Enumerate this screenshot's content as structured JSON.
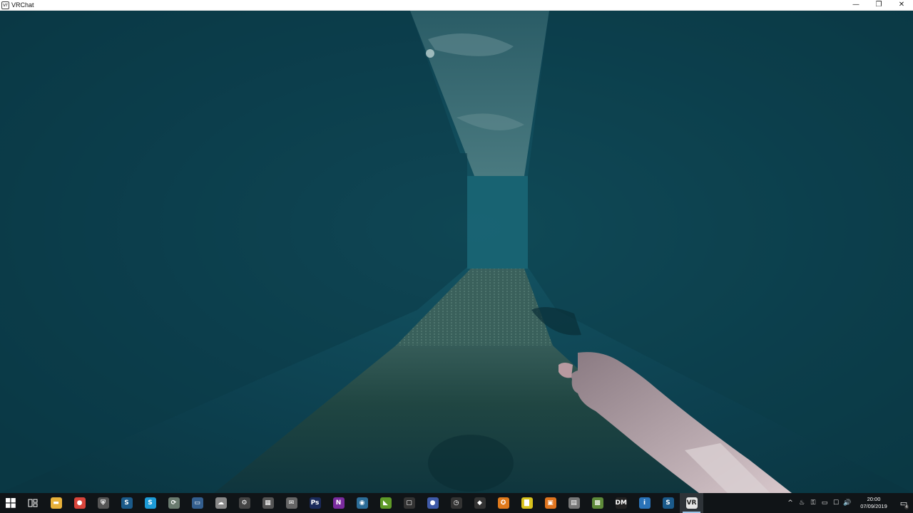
{
  "window": {
    "title": "VRChat",
    "app_icon": "vr",
    "controls": {
      "minimize": "—",
      "restore": "❐",
      "close": "✕"
    }
  },
  "game": {
    "scene": "dark teal underwater-looking corridor with tiled floor, sky visible through ceiling opening, first-person avatar arm pointing",
    "fog_color": "#0d3d4a",
    "floor_color": "#3a5a55"
  },
  "taskbar": {
    "start_icon": "windows-logo-icon",
    "task_view_icon": "task-view-icon",
    "apps": [
      {
        "name": "file-explorer-icon",
        "glyph": "▬",
        "color": "#e8b13a"
      },
      {
        "name": "chrome-icon",
        "glyph": "●",
        "color": "#d8453b"
      },
      {
        "name": "security-shield-icon",
        "glyph": "⛨",
        "color": "#555"
      },
      {
        "name": "steam-icon",
        "glyph": "S",
        "color": "#1b5a8a"
      },
      {
        "name": "skype-icon",
        "glyph": "S",
        "color": "#1d9bd7"
      },
      {
        "name": "app-swirl-icon",
        "glyph": "⟳",
        "color": "#6a7b6f"
      },
      {
        "name": "monitor-app-icon",
        "glyph": "▭",
        "color": "#335e8e"
      },
      {
        "name": "cloud-app-icon",
        "glyph": "☁",
        "color": "#888"
      },
      {
        "name": "settings-gear-icon",
        "glyph": "⚙",
        "color": "#444"
      },
      {
        "name": "calculator-icon",
        "glyph": "▦",
        "color": "#555"
      },
      {
        "name": "mail-app-icon",
        "glyph": "✉",
        "color": "#666"
      },
      {
        "name": "photoshop-icon",
        "glyph": "Ps",
        "color": "#1a2a5a"
      },
      {
        "name": "onenote-icon",
        "glyph": "N",
        "color": "#7a2b9e"
      },
      {
        "name": "blue-circle-app-icon",
        "glyph": "◉",
        "color": "#2c6d98"
      },
      {
        "name": "nvidia-icon",
        "glyph": "◣",
        "color": "#5f9a28"
      },
      {
        "name": "oculus-icon",
        "glyph": "▢",
        "color": "#333"
      },
      {
        "name": "discord-icon",
        "glyph": "●",
        "color": "#3f5aa8"
      },
      {
        "name": "alarm-clock-icon",
        "glyph": "◷",
        "color": "#333"
      },
      {
        "name": "unity-icon",
        "glyph": "◆",
        "color": "#333"
      },
      {
        "name": "blender-icon",
        "glyph": "✪",
        "color": "#e07a1c"
      },
      {
        "name": "sticky-notes-icon",
        "glyph": "▇",
        "color": "#d9c21d"
      },
      {
        "name": "orange-app-icon",
        "glyph": "▣",
        "color": "#e0751f"
      },
      {
        "name": "disk-app-icon",
        "glyph": "▤",
        "color": "#777"
      },
      {
        "name": "minecraft-icon",
        "glyph": "▩",
        "color": "#5e8a3a"
      },
      {
        "name": "dm-app-icon",
        "glyph": "DM",
        "color": "#222"
      },
      {
        "name": "info-app-icon",
        "glyph": "i",
        "color": "#2a73b8"
      },
      {
        "name": "steam-icon-2",
        "glyph": "S",
        "color": "#1b5a8a"
      },
      {
        "name": "vrchat-icon",
        "glyph": "VR",
        "color": "#e5e5e5",
        "active": true
      }
    ],
    "tray": {
      "icons": [
        "^",
        "♨",
        "⚿",
        "▭",
        "☐",
        "🔊"
      ],
      "time": "20:00",
      "date": "07/09/2019",
      "notification_count": "4"
    }
  }
}
